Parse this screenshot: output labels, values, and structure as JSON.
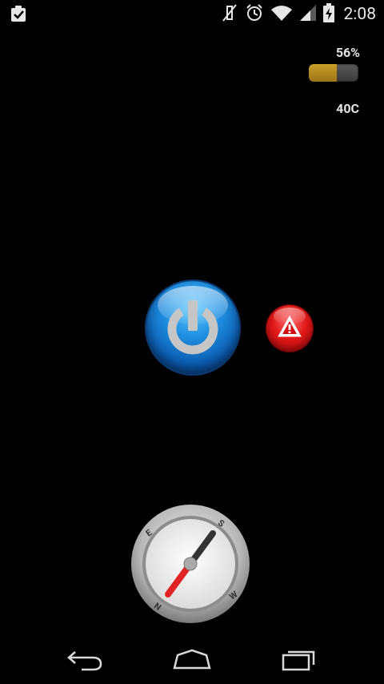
{
  "status_bar": {
    "time": "2:08",
    "icons": [
      "clipboard-check-icon",
      "vibrate-off-icon",
      "alarm-icon",
      "wifi-icon",
      "signal-icon",
      "battery-charging-icon"
    ]
  },
  "battery_widget": {
    "percent_label": "56%",
    "level_fraction": 0.56,
    "temperature_label": "40C",
    "fill_color": "#b8901f"
  },
  "controls": {
    "power_icon": "power-icon",
    "warning_icon": "warning-triangle-icon",
    "compass_icon": "compass-icon",
    "compass_labels": {
      "e": "E",
      "s": "S",
      "n": "N",
      "w": "W"
    }
  },
  "nav_bar": {
    "icons": [
      "back-icon",
      "home-icon",
      "recent-apps-icon"
    ]
  },
  "colors": {
    "power_blue": "#1f8fe0",
    "warning_red": "#e01818",
    "background": "#000000"
  }
}
